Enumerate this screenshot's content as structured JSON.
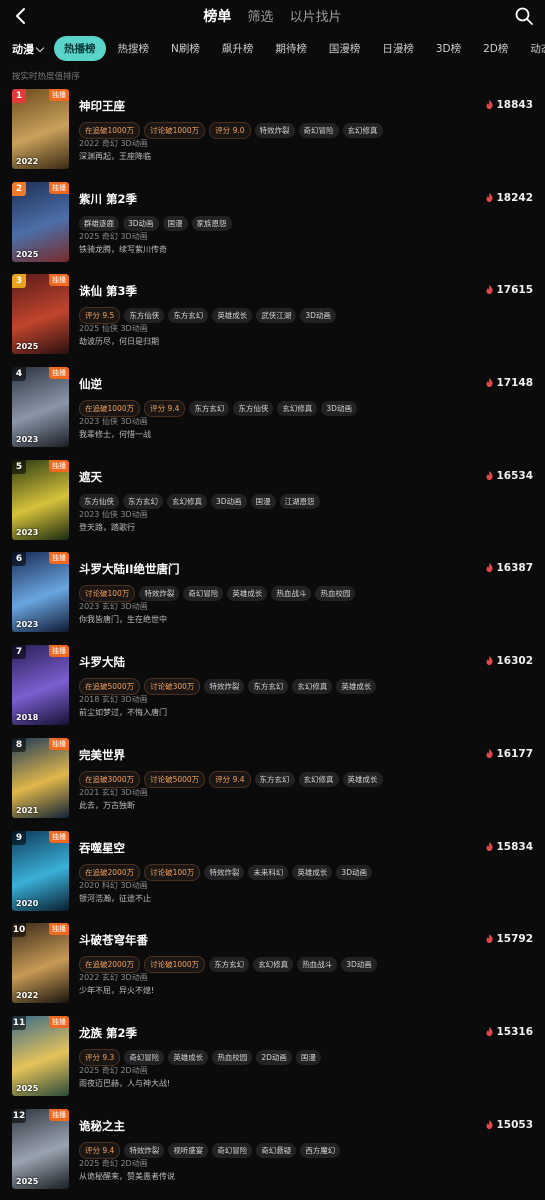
{
  "header": {
    "tabs": [
      "榜单",
      "筛选",
      "以片找片"
    ],
    "active_tab": 0
  },
  "categories": {
    "dropdown": "动漫",
    "items": [
      "热播榜",
      "热搜榜",
      "N刷榜",
      "飙升榜",
      "期待榜",
      "国漫榜",
      "日漫榜",
      "3D榜",
      "2D榜",
      "动态漫榜"
    ],
    "active": 0
  },
  "sort_note": "按实时热度值排序",
  "items": [
    {
      "rank": "1",
      "title": "神印王座",
      "heat": "18843",
      "exclusive": "独播",
      "year": "2022",
      "meta": "2022 奇幻 3D动画",
      "desc": "深渊再起，王座降临",
      "tags": [
        {
          "t": "在追破1000万",
          "k": "hot"
        },
        {
          "t": "讨论破1000万",
          "k": "hot"
        },
        {
          "t": "评分 9.0",
          "k": "hot"
        },
        {
          "t": "特效炸裂"
        },
        {
          "t": "奇幻冒险"
        },
        {
          "t": "玄幻修真"
        }
      ],
      "colors": [
        "#6b4a1e",
        "#c9a15a",
        "#3a2a14"
      ]
    },
    {
      "rank": "2",
      "title": "紫川 第2季",
      "heat": "18242",
      "exclusive": "独播",
      "year": "2025",
      "meta": "2025 奇幻 3D动画",
      "desc": "铁骑龙腾，续写紫川传奇",
      "tags": [
        {
          "t": "群雄逐鹿"
        },
        {
          "t": "3D动画"
        },
        {
          "t": "国漫"
        },
        {
          "t": "家族恩怨"
        }
      ],
      "colors": [
        "#1e2f55",
        "#4c6fa8",
        "#7a2a2a"
      ]
    },
    {
      "rank": "3",
      "title": "诛仙 第3季",
      "heat": "17615",
      "exclusive": "独播",
      "year": "2025",
      "meta": "2025 仙侠 3D动画",
      "desc": "劫波历尽，何日是归期",
      "tags": [
        {
          "t": "评分 9.5",
          "k": "hot"
        },
        {
          "t": "东方仙侠"
        },
        {
          "t": "东方玄幻"
        },
        {
          "t": "英雄成长"
        },
        {
          "t": "武侠江湖"
        },
        {
          "t": "3D动画"
        }
      ],
      "colors": [
        "#5a1a1a",
        "#c0452d",
        "#2a1010"
      ]
    },
    {
      "rank": "4",
      "title": "仙逆",
      "heat": "17148",
      "exclusive": "独播",
      "year": "2023",
      "meta": "2023 仙侠 3D动画",
      "desc": "我辈修士，何惜一战",
      "tags": [
        {
          "t": "在追破1000万",
          "k": "hot"
        },
        {
          "t": "评分 9.4",
          "k": "hot"
        },
        {
          "t": "东方玄幻"
        },
        {
          "t": "东方仙侠"
        },
        {
          "t": "玄幻修真"
        },
        {
          "t": "3D动画"
        }
      ],
      "colors": [
        "#2c3340",
        "#8a97a8",
        "#1a1e26"
      ]
    },
    {
      "rank": "5",
      "title": "遮天",
      "heat": "16534",
      "exclusive": "独播",
      "year": "2023",
      "meta": "2023 仙侠 3D动画",
      "desc": "登天路，踏歌行",
      "tags": [
        {
          "t": "东方仙侠"
        },
        {
          "t": "东方玄幻"
        },
        {
          "t": "玄幻修真"
        },
        {
          "t": "3D动画"
        },
        {
          "t": "国漫"
        },
        {
          "t": "江湖恩怨"
        }
      ],
      "colors": [
        "#2b3a12",
        "#d6c23a",
        "#1a2a10"
      ]
    },
    {
      "rank": "6",
      "title": "斗罗大陆II绝世唐门",
      "heat": "16387",
      "exclusive": "独播",
      "year": "2023",
      "meta": "2023 玄幻 3D动画",
      "desc": "你我皆唐门，生在绝世中",
      "tags": [
        {
          "t": "讨论破100万",
          "k": "hot"
        },
        {
          "t": "特效炸裂"
        },
        {
          "t": "奇幻冒险"
        },
        {
          "t": "英雄成长"
        },
        {
          "t": "热血战斗"
        },
        {
          "t": "热血校园"
        }
      ],
      "colors": [
        "#1a2b55",
        "#6aa6e0",
        "#101a33"
      ]
    },
    {
      "rank": "7",
      "title": "斗罗大陆",
      "heat": "16302",
      "exclusive": "独播",
      "year": "2018",
      "meta": "2018 玄幻 3D动画",
      "desc": "前尘如梦过，不悔入唐门",
      "tags": [
        {
          "t": "在追破5000万",
          "k": "hot"
        },
        {
          "t": "讨论破300万",
          "k": "hot"
        },
        {
          "t": "特效炸裂"
        },
        {
          "t": "东方玄幻"
        },
        {
          "t": "玄幻修真"
        },
        {
          "t": "英雄成长"
        }
      ],
      "colors": [
        "#2a1e55",
        "#7b5fd0",
        "#161033"
      ]
    },
    {
      "rank": "8",
      "title": "完美世界",
      "heat": "16177",
      "exclusive": "独播",
      "year": "2021",
      "meta": "2021 玄幻 3D动画",
      "desc": "此去，万古独断",
      "tags": [
        {
          "t": "在追破3000万",
          "k": "hot"
        },
        {
          "t": "讨论破5000万",
          "k": "hot"
        },
        {
          "t": "评分 9.4",
          "k": "hot"
        },
        {
          "t": "东方玄幻"
        },
        {
          "t": "玄幻修真"
        },
        {
          "t": "英雄成长"
        }
      ],
      "colors": [
        "#1e3a5a",
        "#e0b74a",
        "#102235"
      ]
    },
    {
      "rank": "9",
      "title": "吞噬星空",
      "heat": "15834",
      "exclusive": "独播",
      "year": "2020",
      "meta": "2020 科幻 3D动画",
      "desc": "银河浩瀚，征途不止",
      "tags": [
        {
          "t": "在追破2000万",
          "k": "hot"
        },
        {
          "t": "讨论破100万",
          "k": "hot"
        },
        {
          "t": "特效炸裂"
        },
        {
          "t": "未来科幻"
        },
        {
          "t": "英雄成长"
        },
        {
          "t": "3D动画"
        }
      ],
      "colors": [
        "#0e3a5a",
        "#3ab0d8",
        "#0a1e30"
      ]
    },
    {
      "rank": "10",
      "title": "斗破苍穹年番",
      "heat": "15792",
      "exclusive": "独播",
      "year": "2022",
      "meta": "2022 玄幻 3D动画",
      "desc": "少年不屈，异火不熄!",
      "tags": [
        {
          "t": "在追破2000万",
          "k": "hot"
        },
        {
          "t": "讨论破1000万",
          "k": "hot"
        },
        {
          "t": "东方玄幻"
        },
        {
          "t": "玄幻修真"
        },
        {
          "t": "热血战斗"
        },
        {
          "t": "3D动画"
        }
      ],
      "colors": [
        "#3a2a1a",
        "#c79a55",
        "#1a140e"
      ]
    },
    {
      "rank": "11",
      "title": "龙族 第2季",
      "heat": "15316",
      "exclusive": "独播",
      "year": "2025",
      "meta": "2025 奇幻 2D动画",
      "desc": "雨夜迈巴赫，人与神大战!",
      "tags": [
        {
          "t": "评分 9.3",
          "k": "hot"
        },
        {
          "t": "奇幻冒险"
        },
        {
          "t": "英雄成长"
        },
        {
          "t": "热血校园"
        },
        {
          "t": "2D动画"
        },
        {
          "t": "国漫"
        }
      ],
      "colors": [
        "#3a6a8a",
        "#e6c35a",
        "#2a4a3a"
      ]
    },
    {
      "rank": "12",
      "title": "诡秘之主",
      "heat": "15053",
      "exclusive": "独播",
      "year": "2025",
      "meta": "2025 奇幻 2D动画",
      "desc": "从诡秘醒来，赞美愚者传说",
      "tags": [
        {
          "t": "评分 9.4",
          "k": "hot"
        },
        {
          "t": "特效炸裂"
        },
        {
          "t": "视听盛宴"
        },
        {
          "t": "奇幻冒险"
        },
        {
          "t": "奇幻悬疑"
        },
        {
          "t": "西方魔幻"
        }
      ],
      "colors": [
        "#2e3540",
        "#9aa4b0",
        "#1a1e24"
      ]
    }
  ]
}
